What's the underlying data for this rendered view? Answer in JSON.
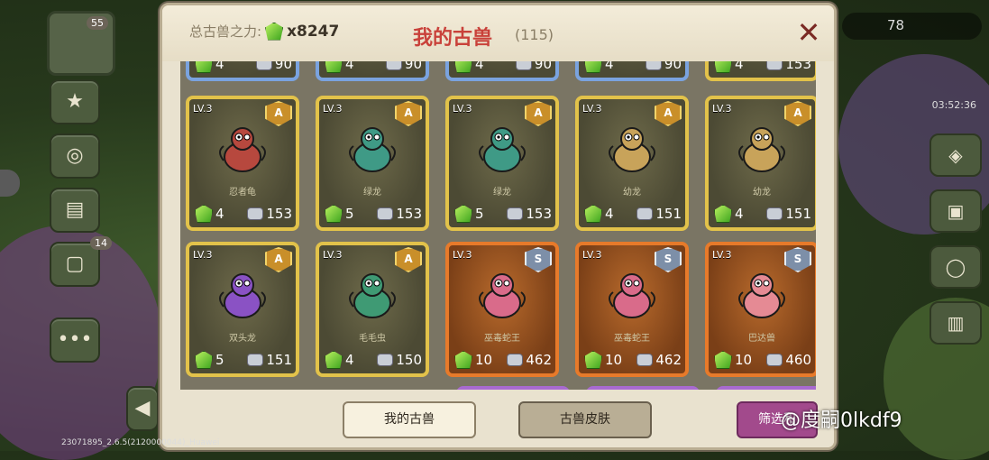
{
  "panel": {
    "total_label": "总古兽之力:",
    "total_value": "x8247",
    "title": "我的古兽",
    "count": "(115)",
    "close_glyph": "✕"
  },
  "top_row": [
    {
      "gems": "4",
      "power": "90"
    },
    {
      "gems": "4",
      "power": "90"
    },
    {
      "gems": "4",
      "power": "90"
    },
    {
      "gems": "4",
      "power": "90"
    },
    {
      "gems": "4",
      "power": "153"
    }
  ],
  "cards": [
    {
      "level": "LV.3",
      "rank": "A",
      "name": "忍者龟",
      "gems": "4",
      "power": "153",
      "style": "gold",
      "color": "#b7483e"
    },
    {
      "level": "LV.3",
      "rank": "A",
      "name": "绿龙",
      "gems": "5",
      "power": "153",
      "style": "gold",
      "color": "#3f9a86"
    },
    {
      "level": "LV.3",
      "rank": "A",
      "name": "绿龙",
      "gems": "5",
      "power": "153",
      "style": "gold",
      "color": "#3f9a86"
    },
    {
      "level": "LV.3",
      "rank": "A",
      "name": "幼龙",
      "gems": "4",
      "power": "151",
      "style": "gold",
      "color": "#c8a35a"
    },
    {
      "level": "LV.3",
      "rank": "A",
      "name": "幼龙",
      "gems": "4",
      "power": "151",
      "style": "gold",
      "color": "#c8a35a"
    },
    {
      "level": "LV.3",
      "rank": "A",
      "name": "双头龙",
      "gems": "5",
      "power": "151",
      "style": "gold",
      "color": "#8a52c4"
    },
    {
      "level": "LV.3",
      "rank": "A",
      "name": "毛毛虫",
      "gems": "4",
      "power": "150",
      "style": "gold",
      "color": "#3f9a74"
    },
    {
      "level": "LV.3",
      "rank": "S",
      "name": "巫毒蛇王",
      "gems": "10",
      "power": "462",
      "style": "orange",
      "color": "#d96b8a"
    },
    {
      "level": "LV.3",
      "rank": "S",
      "name": "巫毒蛇王",
      "gems": "10",
      "power": "462",
      "style": "orange",
      "color": "#d96b8a"
    },
    {
      "level": "LV.3",
      "rank": "S",
      "name": "巴达兽",
      "gems": "10",
      "power": "460",
      "style": "orange",
      "color": "#e58a94"
    }
  ],
  "bottom": {
    "tab_mine": "我的古兽",
    "tab_skin": "古兽皮肤",
    "filter": "筛选和"
  },
  "hud": {
    "left_badge": "55",
    "left_badge2": "14",
    "right_count": "78",
    "right_time": "03:52:36"
  },
  "watermark": "@度嗣0lkdf9",
  "build": "23071895_2.6.5(2120000044)_Huawei"
}
